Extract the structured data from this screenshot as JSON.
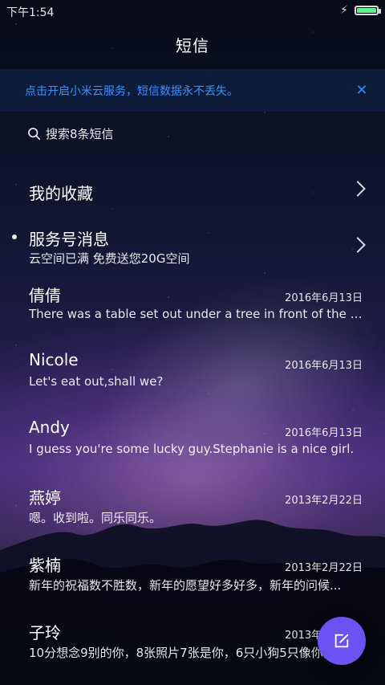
{
  "status_bar": {
    "time": "下午1:54",
    "charging_icon": "lightning-icon",
    "battery_icon": "battery-icon",
    "battery_color": "#5ef08a"
  },
  "header": {
    "title": "短信"
  },
  "cloud_banner": {
    "text": "点击开启小米云服务，短信数据永不丢失。",
    "close_icon": "close-icon",
    "text_color": "#3a8fff"
  },
  "search": {
    "icon": "search-icon",
    "label": "搜索8条短信"
  },
  "list": {
    "favorites": {
      "title": "我的收藏",
      "chevron_icon": "chevron-right-icon"
    },
    "service": {
      "title": "服务号消息",
      "subtitle": "云空间已满 免费送您20G空间",
      "chevron_icon": "chevron-right-icon"
    },
    "conversations": [
      {
        "name": "倩倩",
        "date": "2016年6月13日",
        "preview": "There was a table set out under a tree in front of the ho..."
      },
      {
        "name": "Nicole",
        "date": "2016年6月13日",
        "preview": "Let's eat out,shall we?"
      },
      {
        "name": "Andy",
        "date": "2016年6月13日",
        "preview": "I guess you're some lucky guy.Stephanie is a nice girl."
      },
      {
        "name": "燕婷",
        "date": "2013年2月22日",
        "preview": "嗯。收到啦。同乐同乐。"
      },
      {
        "name": "紫楠",
        "date": "2013年2月22日",
        "preview": "新年的祝福数不胜数，新年的愿望好多好多，新年的问候..."
      },
      {
        "name": "子玲",
        "date": "2013年2月22日",
        "preview": "10分想念9别的你，8张照片7张是你，6只小狗5只像你，4..."
      }
    ]
  },
  "fab": {
    "icon": "compose-icon",
    "color": "#6b52f2"
  }
}
